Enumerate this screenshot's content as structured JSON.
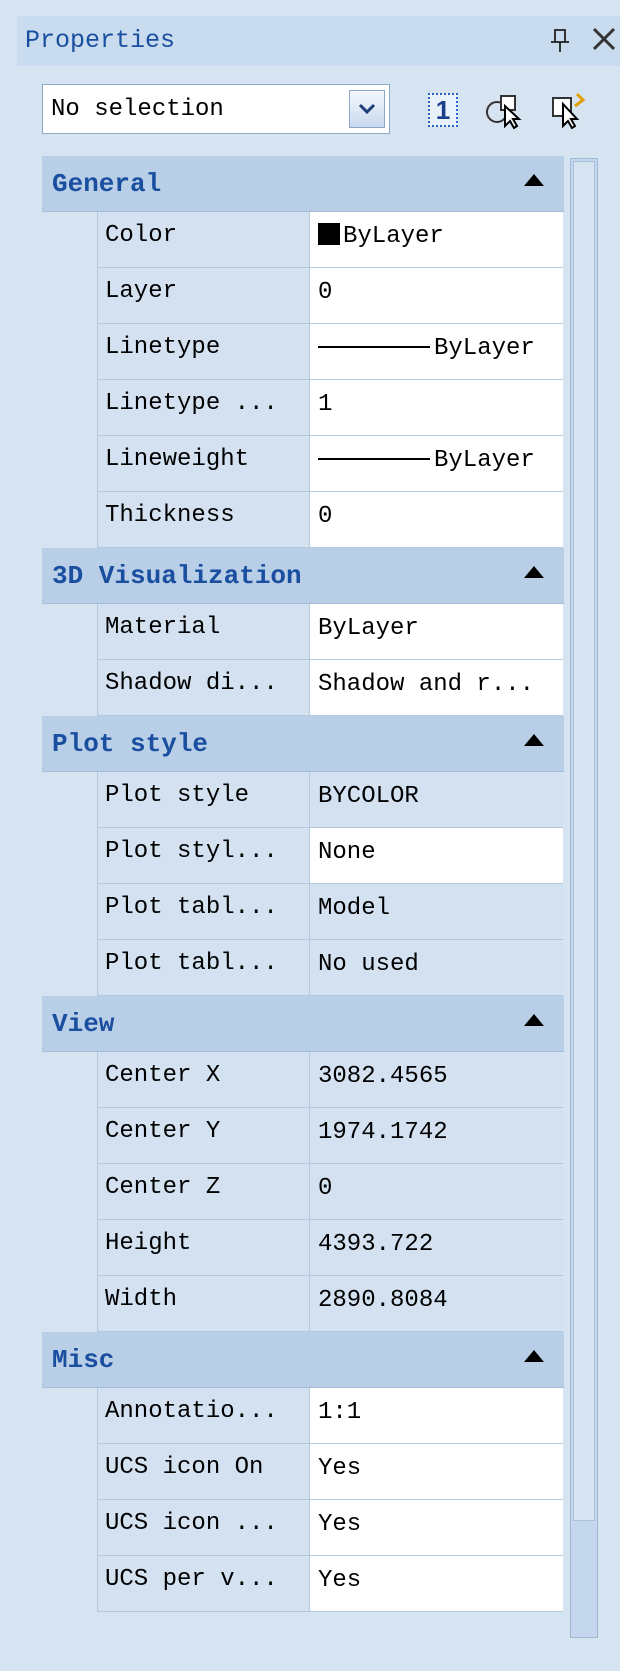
{
  "panel": {
    "title": "Properties"
  },
  "selection": {
    "value": "No selection"
  },
  "toolbar": {
    "quick_select_label": "1"
  },
  "categories": [
    {
      "label": "General",
      "rows": [
        {
          "name": "Color",
          "value": "ByLayer",
          "swatch": "#000000",
          "editable": true
        },
        {
          "name": "Layer",
          "value": "0",
          "editable": true
        },
        {
          "name": "Linetype",
          "value": "ByLayer",
          "line": true,
          "editable": true
        },
        {
          "name": "Linetype ...",
          "value": "1",
          "editable": true
        },
        {
          "name": "Lineweight",
          "value": "ByLayer",
          "line": true,
          "editable": true
        },
        {
          "name": "Thickness",
          "value": "0",
          "editable": true
        }
      ]
    },
    {
      "label": "3D Visualization",
      "rows": [
        {
          "name": "Material",
          "value": "ByLayer",
          "editable": true
        },
        {
          "name": "Shadow di...",
          "value": "Shadow and r...",
          "editable": true
        }
      ]
    },
    {
      "label": "Plot style",
      "rows": [
        {
          "name": "Plot style",
          "value": "BYCOLOR",
          "editable": false
        },
        {
          "name": "Plot styl...",
          "value": "None",
          "editable": true
        },
        {
          "name": "Plot tabl...",
          "value": "Model",
          "editable": false
        },
        {
          "name": "Plot tabl...",
          "value": "No used",
          "editable": false
        }
      ]
    },
    {
      "label": "View",
      "rows": [
        {
          "name": "Center X",
          "value": "3082.4565",
          "editable": false
        },
        {
          "name": "Center Y",
          "value": "1974.1742",
          "editable": false
        },
        {
          "name": "Center Z",
          "value": "0",
          "editable": false
        },
        {
          "name": "Height",
          "value": "4393.722",
          "editable": false
        },
        {
          "name": "Width",
          "value": "2890.8084",
          "editable": false
        }
      ]
    },
    {
      "label": "Misc",
      "rows": [
        {
          "name": "Annotatio...",
          "value": "1:1",
          "editable": true
        },
        {
          "name": "UCS icon On",
          "value": "Yes",
          "editable": true
        },
        {
          "name": "UCS icon ...",
          "value": "Yes",
          "editable": true
        },
        {
          "name": "UCS per v...",
          "value": "Yes",
          "editable": true
        }
      ]
    }
  ]
}
